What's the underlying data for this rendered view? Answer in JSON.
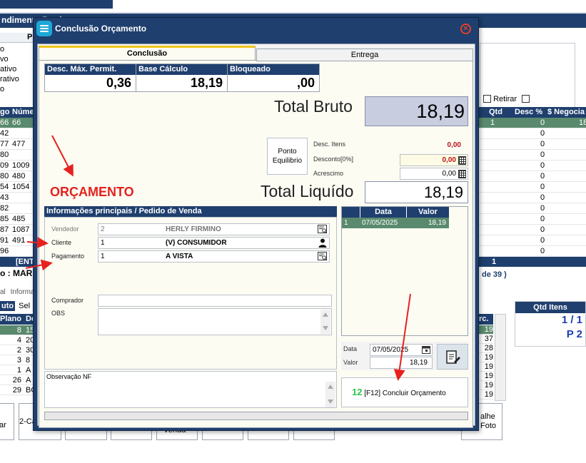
{
  "background": {
    "title_fragment": "ndimento Produtos",
    "left_list": [
      "o",
      "vo",
      "ativo",
      "rativo",
      "o"
    ],
    "left_header": "P",
    "grid_headers": [
      "go",
      "Núme"
    ],
    "rows_left": [
      [
        "66",
        "66"
      ],
      [
        "42",
        ""
      ],
      [
        "77",
        "477"
      ],
      [
        "80",
        ""
      ],
      [
        "09",
        "1009"
      ],
      [
        "80",
        "480"
      ],
      [
        "54",
        "1054"
      ],
      [
        "43",
        ""
      ],
      [
        "82",
        ""
      ],
      [
        "85",
        "485"
      ],
      [
        "87",
        "1087"
      ],
      [
        "91",
        "491"
      ],
      [
        "96",
        ""
      ]
    ],
    "right_headers": [
      "Qtd",
      "Desc %",
      "$ Negocia"
    ],
    "right_rows": [
      [
        "1",
        "0",
        "18"
      ],
      [
        "",
        "0",
        ""
      ],
      [
        "",
        "0",
        ""
      ],
      [
        "",
        "0",
        ""
      ],
      [
        "",
        "0",
        ""
      ],
      [
        "",
        "0",
        ""
      ],
      [
        "",
        "0",
        ""
      ],
      [
        "",
        "0",
        ""
      ],
      [
        "",
        "0",
        ""
      ],
      [
        "",
        "0",
        ""
      ],
      [
        "",
        "0",
        ""
      ],
      [
        "",
        "0",
        ""
      ],
      [
        "",
        "0",
        ""
      ]
    ],
    "retirar_label": "Retirar",
    "totals_row_left": "[ENT",
    "totals_row_right": "1",
    "client_line": "o : MAR",
    "page_info": "de 39 )",
    "tabs_left": [
      "al",
      "Informa"
    ],
    "sub_tabs": [
      "uto",
      "Sel"
    ],
    "plan_header": [
      "Plano",
      "De"
    ],
    "plan_rows": [
      [
        "8",
        "15"
      ],
      [
        "4",
        "20"
      ],
      [
        "2",
        "30"
      ],
      [
        "3",
        "8"
      ],
      [
        "1",
        "A"
      ],
      [
        "26",
        "A"
      ],
      [
        "29",
        "BO"
      ]
    ],
    "rc_header": "rc.",
    "rc_values": [
      "19",
      "37",
      "28",
      "19",
      "19",
      "19",
      "19",
      "19"
    ],
    "qtd_itens": {
      "header": "Qtd Itens",
      "v1": "1 / 1",
      "v2": "P 2"
    },
    "bottom_buttons": [
      "ar",
      "2-Ca",
      "",
      "",
      "Venda",
      "",
      "",
      "",
      "alhe Foto"
    ]
  },
  "dialog": {
    "title": "Conclusão Orçamento",
    "close_symbol": "×",
    "tabs": [
      {
        "label": "Conclusão"
      },
      {
        "label": "Entrega"
      }
    ],
    "discount_table": {
      "headers": [
        "Desc. Máx. Permit.",
        "Base Cálculo",
        "Bloqueado"
      ],
      "values": [
        "0,36",
        "18,19",
        ",00"
      ]
    },
    "total_bruto": {
      "label": "Total Bruto",
      "value": "18,19"
    },
    "ponto_equilibrio": "Ponto Equilibrio",
    "desc_itens": {
      "label": "Desc. Itens",
      "value": "0,00"
    },
    "desconto": {
      "label": "Desconto[0%]",
      "value": "0,00"
    },
    "acrescimo": {
      "label": "Acrescimo",
      "value": "0,00"
    },
    "total_liquido": {
      "label": "Total Liquído",
      "value": "18,19"
    },
    "orcamento_label": "ORÇAMENTO",
    "info_section": {
      "header": "Informações principais / Pedido de Venda",
      "vendedor": {
        "label": "Vendedor",
        "code": "2",
        "name": "HERLY FIRMINO"
      },
      "cliente": {
        "label": "Cliente",
        "code": "1",
        "name": "(V) CONSUMIDOR"
      },
      "pagamento": {
        "label": "Pagamento",
        "code": "1",
        "name": "A VISTA"
      },
      "comprador": {
        "label": "Comprador",
        "value": ""
      },
      "obs": {
        "label": "OBS",
        "value": ""
      }
    },
    "observacao_nf": {
      "label": "Observação NF",
      "value": ""
    },
    "parcelas": {
      "headers": [
        "Data",
        "Valor"
      ],
      "rows": [
        {
          "num": "1",
          "data": "07/05/2025",
          "valor": "18,19"
        }
      ]
    },
    "data_field": {
      "label": "Data",
      "value": "07/05/2025"
    },
    "valor_field": {
      "label": "Valor",
      "value": "18,19"
    },
    "concluir_button": {
      "key": "12",
      "label": "[F12] Concluir Orçamento"
    }
  },
  "colors": {
    "header_navy": "#1f3f6e",
    "selected_row": "#5a8a6e",
    "annotation_red": "#e5221e",
    "total_bruto_bg": "#c9cde0",
    "tab_accent": "#f0c419"
  }
}
